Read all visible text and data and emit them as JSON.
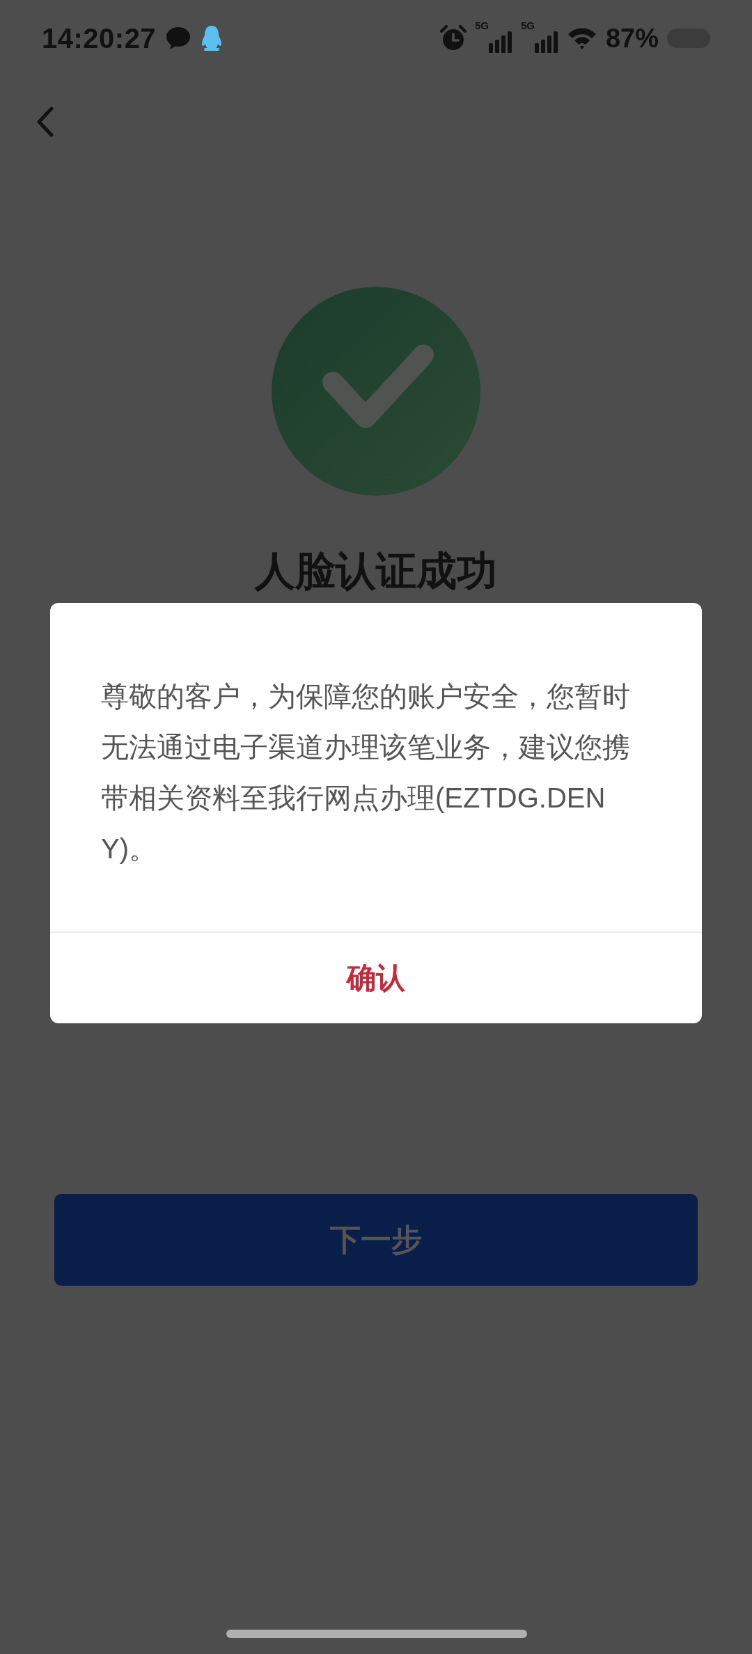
{
  "status_bar": {
    "time": "14:20:27",
    "network_1": "5G",
    "network_2": "5G",
    "battery": "87%"
  },
  "title": "人脸认证成功",
  "dialog": {
    "message": "尊敬的客户，为保障您的账户安全，您暂时无法通过电子渠道办理该笔业务，建议您携带相关资料至我行网点办理(EZTDG.DENY)。",
    "confirm": "确认"
  },
  "next_button": {
    "label": "下一步",
    "disabled": true
  }
}
